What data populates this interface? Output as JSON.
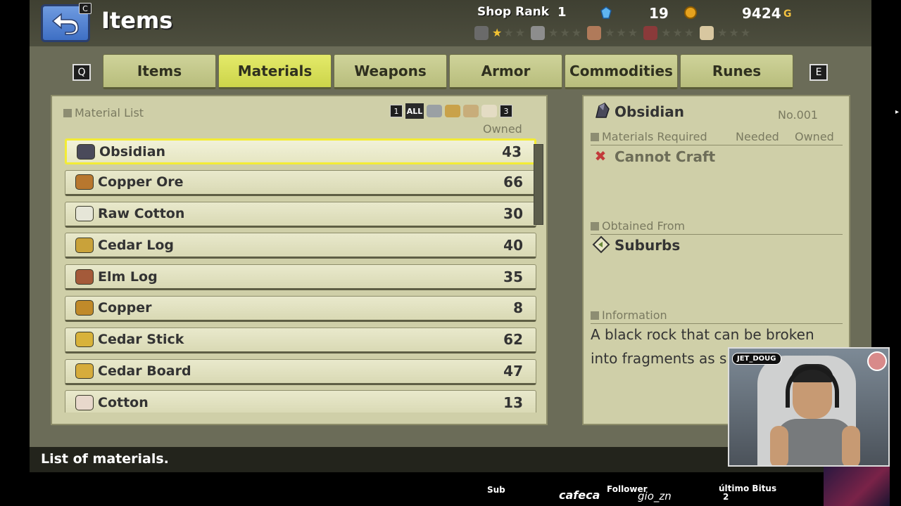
{
  "header": {
    "title": "Items",
    "back_key": "C",
    "shop_rank_label": "Shop Rank",
    "shop_rank_value": "1",
    "gems": "19",
    "gold": "9424",
    "gold_unit": "G",
    "rank_icons": [
      "pickaxe-icon",
      "stone-icon",
      "log-icon",
      "board-icon",
      "cloth-icon"
    ],
    "rank_stars": [
      1,
      0,
      0,
      0,
      0
    ]
  },
  "tabs": {
    "prev_key": "Q",
    "next_key": "E",
    "items": [
      "Items",
      "Materials",
      "Weapons",
      "Armor",
      "Commodities",
      "Runes"
    ],
    "active": "Materials"
  },
  "material_list": {
    "title": "Material List",
    "filter_page_prev": "1",
    "filter_all": "ALL",
    "filter_page_next": "3",
    "owned_header": "Owned",
    "rows": [
      {
        "name": "Obsidian",
        "count": "43",
        "icon": "obsidian-icon",
        "selected": true
      },
      {
        "name": "Copper Ore",
        "count": "66",
        "icon": "copper-ore-icon"
      },
      {
        "name": "Raw Cotton",
        "count": "30",
        "icon": "raw-cotton-icon"
      },
      {
        "name": "Cedar Log",
        "count": "40",
        "icon": "cedar-log-icon"
      },
      {
        "name": "Elm Log",
        "count": "35",
        "icon": "elm-log-icon"
      },
      {
        "name": "Copper",
        "count": "8",
        "icon": "copper-ingot-icon"
      },
      {
        "name": "Cedar Stick",
        "count": "62",
        "icon": "cedar-stick-icon"
      },
      {
        "name": "Cedar Board",
        "count": "47",
        "icon": "cedar-board-icon"
      },
      {
        "name": "Cotton",
        "count": "13",
        "icon": "cotton-icon"
      }
    ]
  },
  "detail": {
    "name": "Obsidian",
    "number": "No.001",
    "materials_required_label": "Materials Required",
    "needed_label": "Needed",
    "owned_label": "Owned",
    "craft_status": "Cannot Craft",
    "obtained_from_label": "Obtained From",
    "location": "Suburbs",
    "information_label": "Information",
    "information_text": "A black rock that can be broken into fragments as s"
  },
  "help_text": "List of materials.",
  "stream": {
    "cam_name": "JET_DOUG",
    "sub_label": "Sub",
    "sub_name": "cafeca",
    "follower_label": "Follower",
    "follower_name": "gio_zn",
    "bits_label": "último Bitus",
    "bits_value": "2"
  },
  "colors": {
    "tab_active": "#e4ea6a",
    "tab_inactive": "#cfd39a",
    "panel_bg": "#cfcfa8",
    "selection_border": "#f3ec35",
    "star_on": "#f3c232"
  }
}
